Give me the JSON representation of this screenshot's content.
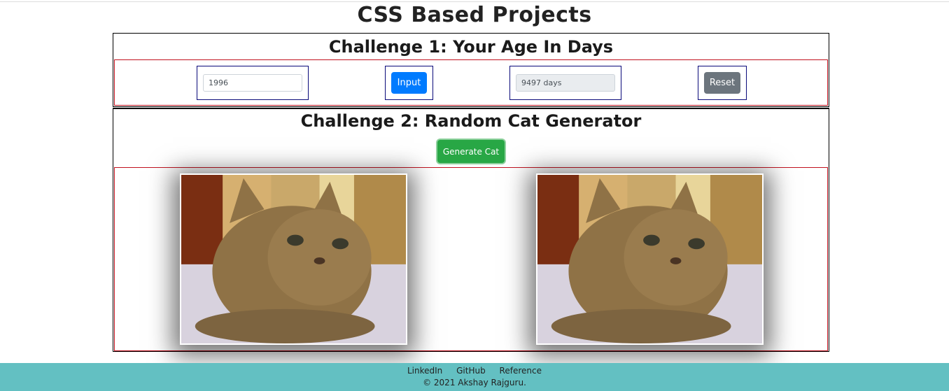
{
  "page": {
    "title": "CSS Based Projects"
  },
  "challenge1": {
    "title": "Challenge 1: Your Age In Days",
    "birth_year_value": "1996",
    "input_button_label": "Input",
    "result_value": "9497 days",
    "reset_button_label": "Reset"
  },
  "challenge2": {
    "title": "Challenge 2: Random Cat Generator",
    "generate_button_label": "Generate Cat"
  },
  "footer": {
    "links": [
      "LinkedIn",
      "GitHub",
      "Reference"
    ],
    "copyright": "© 2021 Akshay Rajguru."
  }
}
